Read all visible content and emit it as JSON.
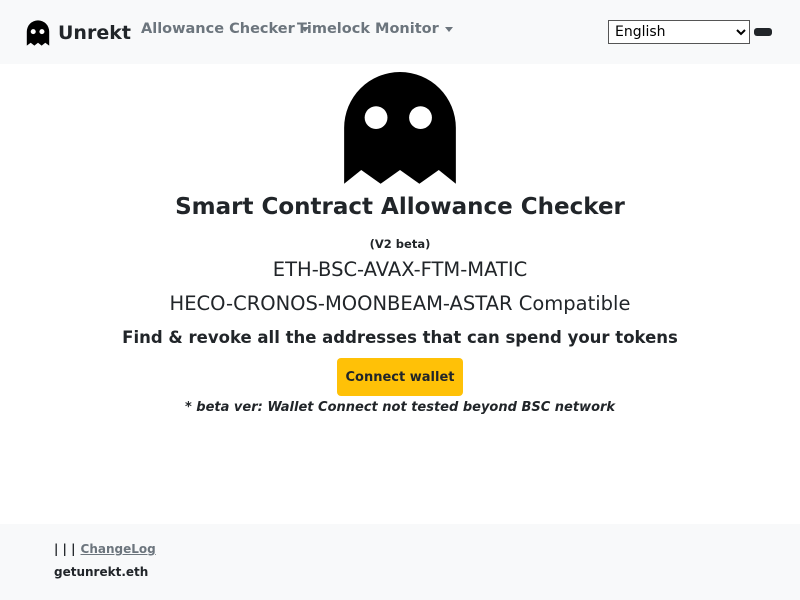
{
  "navbar": {
    "brand": "Unrekt",
    "menus": [
      {
        "label": "Allowance Checker"
      },
      {
        "label": "Timelock Monitor"
      }
    ],
    "language": {
      "selected": "English",
      "options": [
        "English"
      ]
    }
  },
  "hero": {
    "title": "Smart Contract Allowance Checker",
    "version": "(V2 beta)",
    "chains_line": "ETH-BSC-AVAX-FTM-MATIC",
    "compat_line": "HECO-CRONOS-MOONBEAM-ASTAR Compatible",
    "tagline": "Find & revoke all the addresses that can spend your tokens",
    "connect_label": "Connect wallet",
    "beta_note": "* beta ver: Wallet Connect not tested beyond BSC network"
  },
  "footer": {
    "separators": "| | |",
    "changelog": "ChangeLog",
    "ens": "getunrekt.eth"
  },
  "colors": {
    "navbar_bg": "#f8f9fa",
    "accent_button": "#ffc107",
    "muted_link": "#6c757d",
    "text": "#212529"
  },
  "icons": {
    "brand": "ghost-icon",
    "hero": "ghost-icon",
    "dropdown": "caret-down-icon",
    "theme": "theme-toggle-icon"
  }
}
